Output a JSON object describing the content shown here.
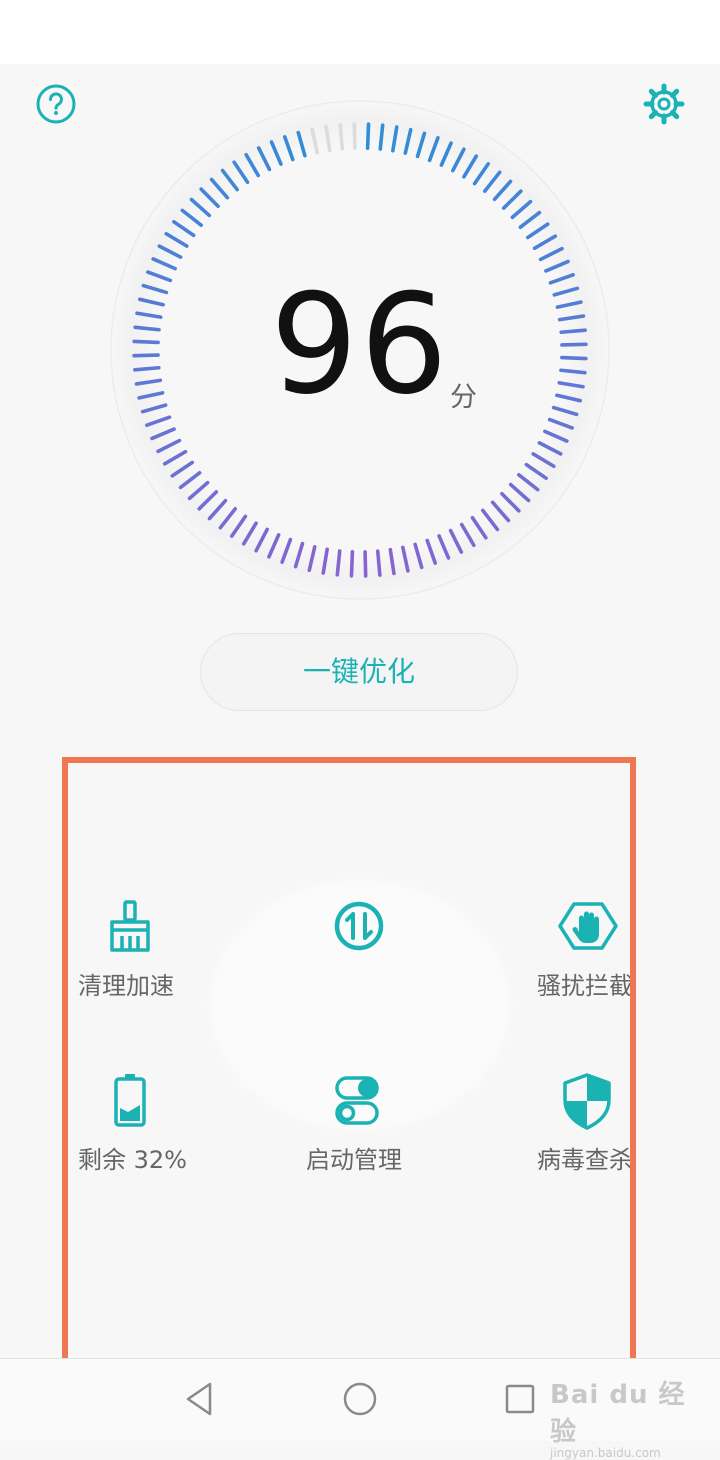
{
  "score": {
    "value": "96",
    "unit": "分"
  },
  "optimize_button": {
    "label": "一键优化"
  },
  "tiles": [
    {
      "label": "清理加速",
      "icon": "broom-icon"
    },
    {
      "label": "",
      "icon": "data-traffic-icon"
    },
    {
      "label": "骚扰拦截",
      "icon": "block-hand-icon"
    },
    {
      "label": "剩余 32%",
      "icon": "battery-icon"
    },
    {
      "label": "启动管理",
      "icon": "toggle-icon"
    },
    {
      "label": "病毒查杀",
      "icon": "shield-icon"
    }
  ],
  "watermark": {
    "brand": "Bai du 经验",
    "url": "jingyan.baidu.com"
  },
  "colors": {
    "accent": "#1bb2b4",
    "dial_start": "#2e8fd8",
    "dial_end": "#8a63d2",
    "dial_inactive": "#dcdcdc",
    "highlight": "#ef7751"
  }
}
